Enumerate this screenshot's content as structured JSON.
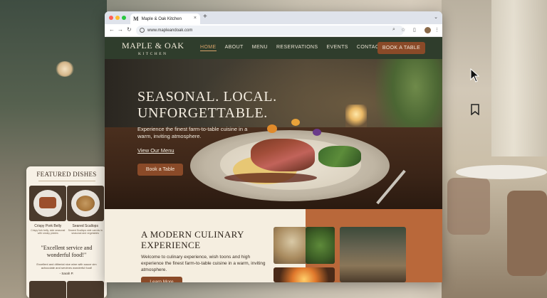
{
  "browser": {
    "tab_icon": "M",
    "tab_title": "Maple & Oak Kitchen",
    "tab_close": "×",
    "new_tab": "+",
    "url": "www.mapleandoak.com",
    "nav_back": "←",
    "nav_forward": "→",
    "nav_reload": "↻"
  },
  "site": {
    "logo_main": "MAPLE & OAK",
    "logo_sub": "KITCHEN",
    "menu": [
      {
        "label": "HOME",
        "active": true
      },
      {
        "label": "ABOUT"
      },
      {
        "label": "MENU"
      },
      {
        "label": "RESERVATIONS"
      },
      {
        "label": "EVENTS"
      },
      {
        "label": "CONTACT"
      }
    ],
    "nav_button": "BOOK A TABLE",
    "hero": {
      "line1": "SEASONAL. LOCAL.",
      "line2": "UNFORGETTABLE.",
      "subtitle": "Experience the finest farm-to-table cuisine in a warm, inviting atmosphere.",
      "link": "View Our Menu",
      "button": "Book a Table"
    },
    "about": {
      "title_line1": "A MODERN CULINARY",
      "title_line2": "EXPERIENCE",
      "body": "Welcome to culinary experience, wish toons and high experience the finest farm-to-table cuisine in a warm, inviting atmosphere.",
      "button": "Learn More"
    }
  },
  "side_card": {
    "title": "FEATURED DISHES",
    "dishes": [
      {
        "name": "Crispy Pork Belly",
        "desc": "Crispy fork belly, side seasonal with smoky pickles"
      },
      {
        "name": "Seared Scallops",
        "desc": "Seared Scallops side carrots in seasonal and vegetables"
      }
    ],
    "quote_line1": "\"Excellent service and",
    "quote_line2": "wonderful food!\"",
    "quote_body": "Excellent and ditherial nice wine with sauce vim achocolate and servines wonderful food!",
    "quote_author": "- Sarah P."
  },
  "colors": {
    "nav_bg": "#2f3d2c",
    "accent": "#8a4a28",
    "terracotta": "#b9683a",
    "cream": "#f5eee0"
  }
}
